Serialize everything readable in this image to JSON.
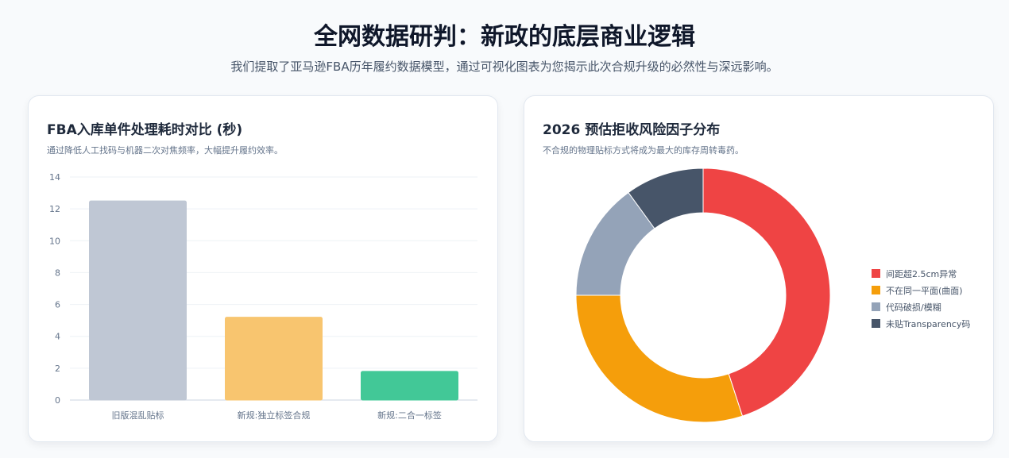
{
  "header": {
    "title": "全网数据研判：新政的底层商业逻辑",
    "subtitle": "我们提取了亚马逊FBA历年履约数据模型，通过可视化图表为您揭示此次合规升级的必然性与深远影响。"
  },
  "left_card": {
    "title": "FBA入库单件处理耗时对比 (秒)",
    "desc": "通过降低人工找码与机器二次对焦频率，大幅提升履约效率。"
  },
  "right_card": {
    "title": "2026 预估拒收风险因子分布",
    "desc": "不合规的物理贴标方式将成为最大的库存周转毒药。"
  },
  "chart_data": [
    {
      "type": "bar",
      "title": "FBA入库单件处理耗时对比 (秒)",
      "categories": [
        "旧版混乱贴标",
        "新规:独立标签合规",
        "新规:二合一标签"
      ],
      "values": [
        12.5,
        5.2,
        1.8
      ],
      "colors": [
        "#bfc7d4",
        "#f8c56f",
        "#42c897"
      ],
      "ylim": [
        0,
        14
      ],
      "yticks": [
        0,
        2,
        4,
        6,
        8,
        10,
        12,
        14
      ],
      "grid": true
    },
    {
      "type": "pie",
      "title": "2026 预估拒收风险因子分布",
      "labels": [
        "间距超2.5cm异常",
        "不在同一平面(曲面)",
        "代码破损/模糊",
        "未贴Transparency码"
      ],
      "values": [
        45,
        30,
        15,
        10
      ],
      "colors": [
        "#ef4444",
        "#f59e0b",
        "#94a3b8",
        "#475569"
      ],
      "donut": true,
      "legend_position": "right"
    }
  ]
}
